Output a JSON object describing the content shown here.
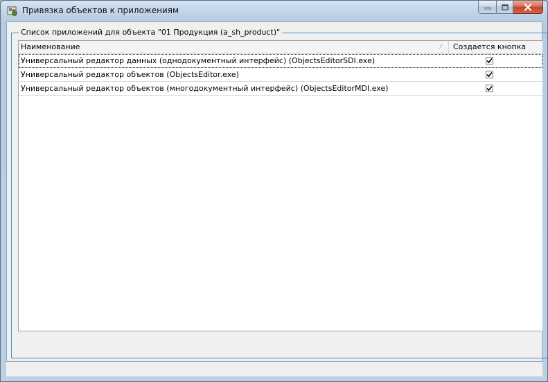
{
  "window": {
    "title": "Привязка объектов к приложениям",
    "icon": "app-binding-icon"
  },
  "caption_buttons": [
    "minimize-icon",
    "maximize-icon",
    "close-icon"
  ],
  "group": {
    "caption": "Список приложений для объекта \"01 Продукция (a_sh_product)\""
  },
  "grid": {
    "columns": [
      {
        "label": "Наименование",
        "sort_mark": "⁄"
      },
      {
        "label": "Создается кнопка"
      }
    ],
    "rows": [
      {
        "name": "Универсальный редактор данных (однодокументный интерфейс) (ObjectsEditorSDI.exe)",
        "create_button": true
      },
      {
        "name": "Универсальный редактор объектов (ObjectsEditor.exe)",
        "create_button": true
      },
      {
        "name": "Универсальный редактор объектов (многодокументный интерфейс) (ObjectsEditorMDI.exe)",
        "create_button": true
      }
    ]
  }
}
